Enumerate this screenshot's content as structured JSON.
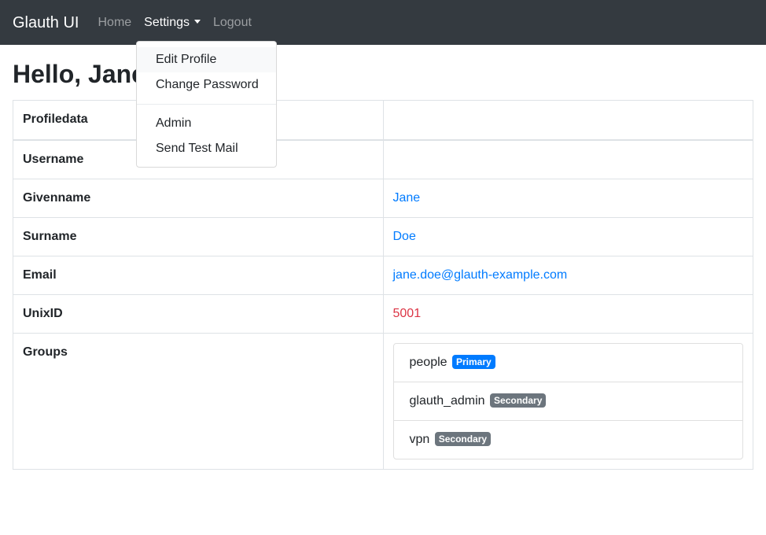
{
  "navbar": {
    "brand": "Glauth UI",
    "home": "Home",
    "settings": "Settings",
    "logout": "Logout"
  },
  "dropdown": {
    "items": [
      "Edit Profile",
      "Change Password",
      "Admin",
      "Send Test Mail"
    ]
  },
  "page": {
    "title": "Hello, Jane"
  },
  "table": {
    "header": "Profiledata",
    "rows": {
      "username": {
        "label": "Username",
        "value": ""
      },
      "givenname": {
        "label": "Givenname",
        "value": "Jane"
      },
      "surname": {
        "label": "Surname",
        "value": "Doe"
      },
      "email": {
        "label": "Email",
        "value": "jane.doe@glauth-example.com"
      },
      "unixid": {
        "label": "UnixID",
        "value": "5001"
      },
      "groups": {
        "label": "Groups"
      }
    }
  },
  "groups": [
    {
      "name": "people",
      "badge": "Primary"
    },
    {
      "name": "glauth_admin",
      "badge": "Secondary"
    },
    {
      "name": "vpn",
      "badge": "Secondary"
    }
  ],
  "colors": {
    "navbar_bg": "#343a40",
    "primary": "#007bff",
    "secondary": "#6c757d",
    "danger": "#dc3545"
  }
}
